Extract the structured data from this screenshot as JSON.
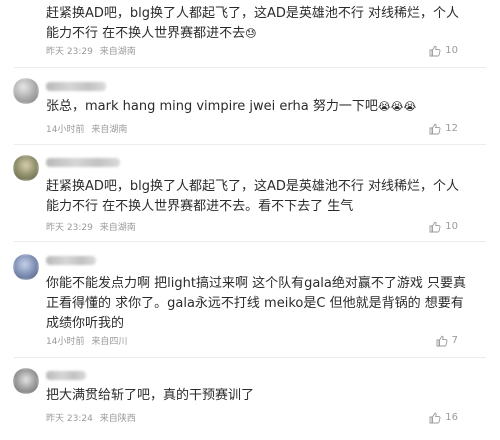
{
  "comments": [
    {
      "text": "赶紧换AD吧，blg换了人都起飞了，这AD是英雄池不行 对线稀烂，个人能力不行 在不换人世界赛都进不去",
      "emoji": "😓",
      "time": "昨天 23:29",
      "location": "来自湖南",
      "likes": "10"
    },
    {
      "text": "张总，mark hang ming vimpire jwei erha 努力一下吧",
      "emoji": "😭😭😭",
      "time": "14小时前",
      "location": "来自湖南",
      "likes": "12"
    },
    {
      "text": "赶紧换AD吧，blg换了人都起飞了，这AD是英雄池不行 对线稀烂，个人能力不行 在不换人世界赛都进不去。看不下去了 生气",
      "emoji": "",
      "time": "昨天 23:29",
      "location": "来自湖南",
      "likes": "10"
    },
    {
      "text": "你能不能发点力啊 把light搞过来啊 这个队有gala绝对赢不了游戏 只要真正看得懂的 求你了。gala永远不打线 meiko是C 但他就是背锅的 想要有成绩你听我的",
      "emoji": "",
      "time": "14小时前",
      "location": "来自四川",
      "likes": "7"
    },
    {
      "text": "把大满贯给斩了吧，真的干预赛训了",
      "emoji": "",
      "time": "昨天 23:24",
      "location": "来自陕西",
      "likes": "16"
    }
  ],
  "icons": {
    "like": "thumbs-up-icon"
  },
  "colors": {
    "text": "#2b2b2b",
    "meta": "#9a9a9a",
    "divider": "#ececec"
  }
}
